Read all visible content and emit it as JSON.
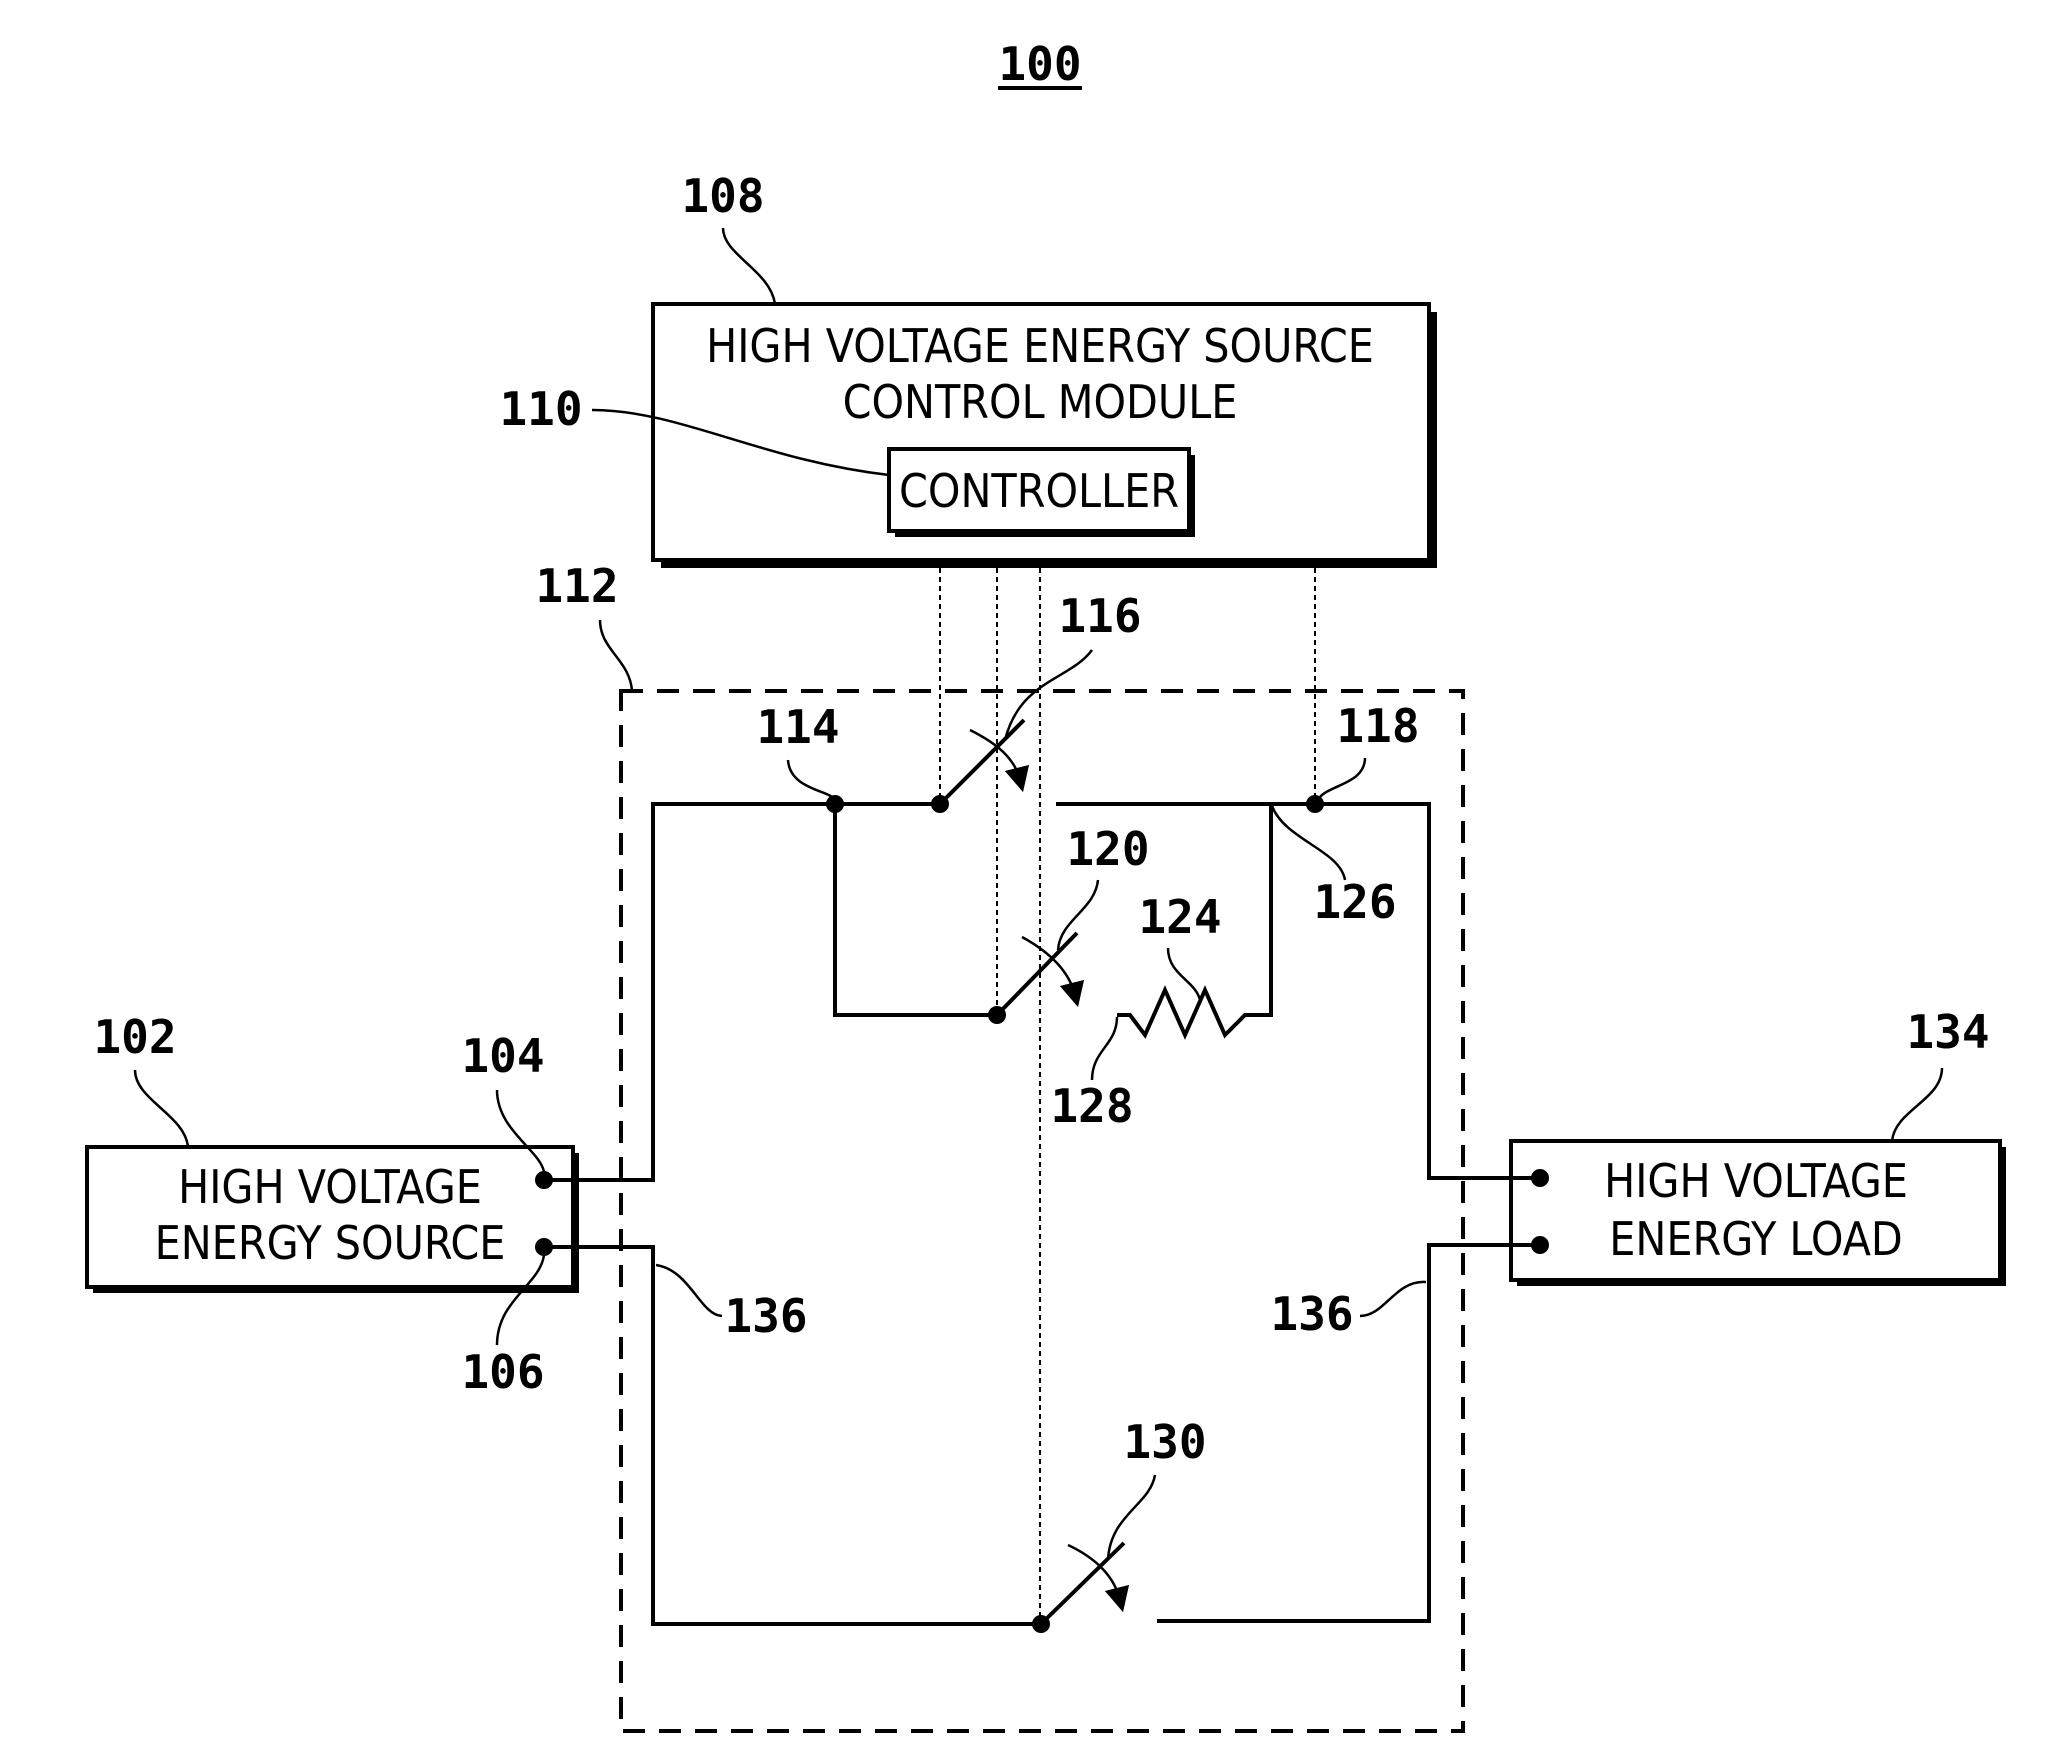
{
  "figure": {
    "number": "100"
  },
  "control_module": {
    "ref": "108",
    "line1": "HIGH VOLTAGE ENERGY SOURCE",
    "line2": "CONTROL MODULE",
    "controller": {
      "ref": "110",
      "label": "CONTROLLER"
    }
  },
  "switching_unit": {
    "ref": "112"
  },
  "source": {
    "ref": "102",
    "line1": "HIGH VOLTAGE",
    "line2": "ENERGY SOURCE",
    "positive_terminal_ref": "104",
    "negative_terminal_ref": "106"
  },
  "load": {
    "ref": "134",
    "line1": "HIGH VOLTAGE",
    "line2": "ENERGY LOAD"
  },
  "nodes": {
    "n114": "114",
    "n118": "118",
    "n126": "126"
  },
  "switches": {
    "s116": "116",
    "s120": "120",
    "s130": "130"
  },
  "resistor": {
    "ref": "124",
    "lead_ref": "128"
  },
  "negative_line": {
    "left_ref": "136",
    "right_ref": "136"
  }
}
